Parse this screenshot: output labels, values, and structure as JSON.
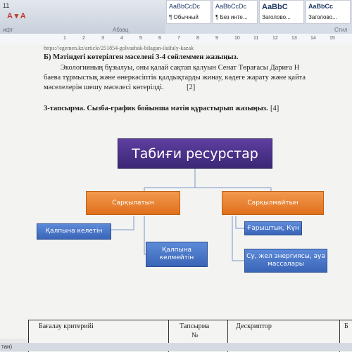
{
  "ribbon": {
    "font_size": "11",
    "styles": [
      {
        "sample": "AaBbCcDc",
        "name": "¶ Обычный"
      },
      {
        "sample": "AaBbCcDc",
        "name": "¶ Без инте..."
      },
      {
        "sample": "AaBbC",
        "name": "Заголово..."
      },
      {
        "sample": "AaBbCc",
        "name": "Заголово..."
      }
    ],
    "section_left": "ифт",
    "section_mid": "Абзац",
    "section_right": "Стил"
  },
  "ruler": {
    "ticks": [
      "1",
      "2",
      "3",
      "4",
      "5",
      "6",
      "7",
      "8",
      "9",
      "10",
      "11",
      "12",
      "13",
      "14",
      "15"
    ]
  },
  "document": {
    "cut_line": "https://egemen.kz/article/251854-golvashak-bilagan-ilaifaly-kazak",
    "heading_b": "Б) Мәтіндегі көтерілген мәселені 3-4 сөйлеммен жазыңыз.",
    "para1": "Экологияның бұзылуы, оны қалай сақтап қалуын Сенат Төрағасы Дариға Н",
    "para2": "баева тұрмыстық және өнеркәсіптік қалдықтарды жинау, кәдеге жарату және қайта",
    "para3": "мәселелерін шешу  мәселесі көтерілді.",
    "para3_mark": "[2]",
    "task3": "3-тапсырма. Сызба-график бойынша мәтін құрастырып жазыңыз.",
    "task3_mark": "[4]"
  },
  "diagram": {
    "root": "Табиғи ресурстар",
    "left": "Сарқылатын",
    "right": "Сарқылмайтын",
    "left_child1": "Қалпына келетін",
    "left_child2_l1": "Қалпына",
    "left_child2_l2": "келмейтін",
    "right_child1": "Ғарыштық, Күн",
    "right_child2_l1": "Су, жел энергиясы, ауа",
    "right_child2_l2": "массалары"
  },
  "table": {
    "col1": "Бағалау критерийі",
    "col2_l1": "Тапсырма",
    "col2_l2": "№",
    "col3": "Дескриптор",
    "col4": "Б"
  },
  "status": {
    "text": "тан)"
  }
}
